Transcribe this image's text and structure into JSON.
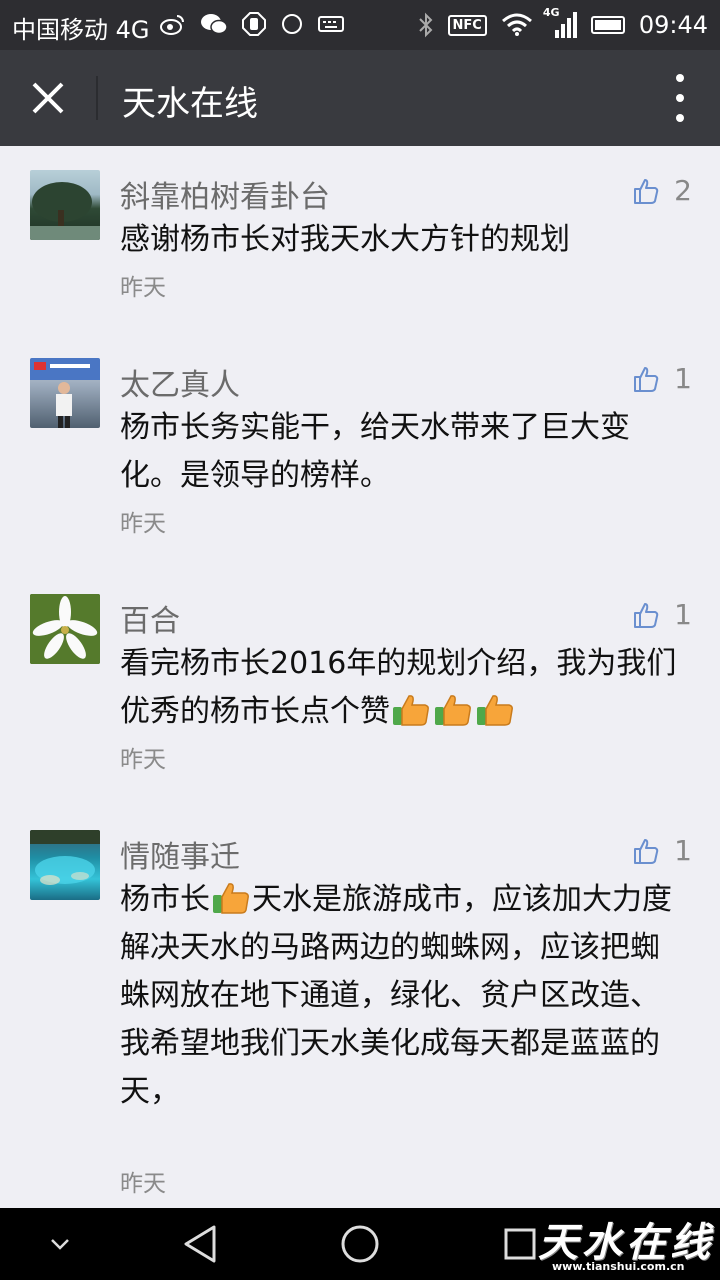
{
  "status": {
    "carrier": "中国移动 4G",
    "net": "4G",
    "nfc": "NFC",
    "time": "09:44",
    "icons": [
      "weibo-icon",
      "wechat-icon",
      "stop-icon",
      "circle-icon",
      "keyboard-icon",
      "bluetooth-icon",
      "nfc-icon",
      "wifi-icon",
      "signal-icon",
      "battery-icon"
    ]
  },
  "header": {
    "title": "天水在线",
    "close_icon": "close-icon",
    "more_icon": "more-vertical-icon"
  },
  "comments": [
    {
      "name": "斜靠柏树看卦台",
      "likes": "2",
      "text": "感谢杨市长对我天水大方针的规划",
      "time": "昨天"
    },
    {
      "name": "太乙真人",
      "likes": "1",
      "text": "杨市长务实能干，给天水带来了巨大变化。是领导的榜样。",
      "time": "昨天"
    },
    {
      "name": "百合",
      "likes": "1",
      "text": "看完杨市长2016年的规划介绍，我为我们优秀的杨市长点个赞",
      "emoji_count": 3,
      "time": "昨天"
    },
    {
      "name": "情随事迁",
      "likes": "1",
      "text_before": "杨市长",
      "text_after": "天水是旅游成市，应该加大力度解决天水的马路两边的蜘蛛网，应该把蜘蛛网放在地下通道，绿化、贫户区改造、我希望地我们天水美化成每天都是蓝蓝的天，",
      "time": "昨天"
    }
  ],
  "navbar": {
    "icons": [
      "chevron-down-icon",
      "back-triangle-icon",
      "home-circle-icon",
      "recents-square-icon"
    ]
  },
  "watermark": {
    "logo": "天水在线",
    "url": "www.tianshui.com.cn"
  },
  "colors": {
    "statusbar": "#2d2d31",
    "topbar": "#393a3f",
    "background": "#efeff4",
    "like_icon": "#6a8fcf"
  }
}
